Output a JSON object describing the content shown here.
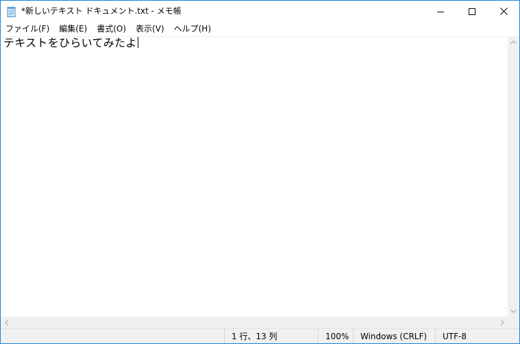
{
  "window": {
    "title": "*新しいテキスト ドキュメント.txt - メモ帳"
  },
  "menu": {
    "items": [
      {
        "label": "ファイル(F)"
      },
      {
        "label": "編集(E)"
      },
      {
        "label": "書式(O)"
      },
      {
        "label": "表示(V)"
      },
      {
        "label": "ヘルプ(H)"
      }
    ]
  },
  "editor": {
    "content": "テキストをひらいてみたよ"
  },
  "status": {
    "position": "1 行、13 列",
    "zoom": "100%",
    "line_ending": "Windows (CRLF)",
    "encoding": "UTF-8"
  },
  "icons": {
    "app": "notepad-icon",
    "minimize": "minimize-icon",
    "maximize": "maximize-icon",
    "close": "close-icon"
  },
  "colors": {
    "window_border": "#1883d7",
    "chrome_gray": "#f0f0f0"
  }
}
